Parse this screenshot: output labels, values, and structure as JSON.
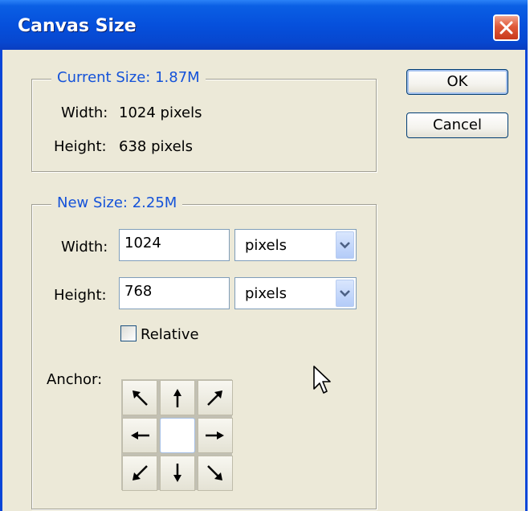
{
  "window": {
    "title": "Canvas Size"
  },
  "current_size": {
    "legend": "Current Size:  1.87M",
    "width_label": "Width:",
    "width_value": "1024 pixels",
    "height_label": "Height:",
    "height_value": "638 pixels"
  },
  "new_size": {
    "legend": "New Size:  2.25M",
    "width_label": "Width:",
    "width_value": "1024",
    "width_unit": "pixels",
    "height_label": "Height:",
    "height_value": "768",
    "height_unit": "pixels",
    "relative_label": "Relative",
    "relative_checked": false,
    "anchor_label": "Anchor:",
    "anchor_cells": [
      "arrow-nw-icon",
      "arrow-n-icon",
      "arrow-ne-icon",
      "arrow-w-icon",
      "anchor-center",
      "arrow-e-icon",
      "arrow-sw-icon",
      "arrow-s-icon",
      "arrow-se-icon"
    ]
  },
  "buttons": {
    "ok": "OK",
    "cancel": "Cancel"
  },
  "colors": {
    "titlebar": "#0650dc",
    "dialog_bg": "#ece9d8",
    "legend_text": "#1452d9",
    "close_button": "#e05a3a"
  }
}
